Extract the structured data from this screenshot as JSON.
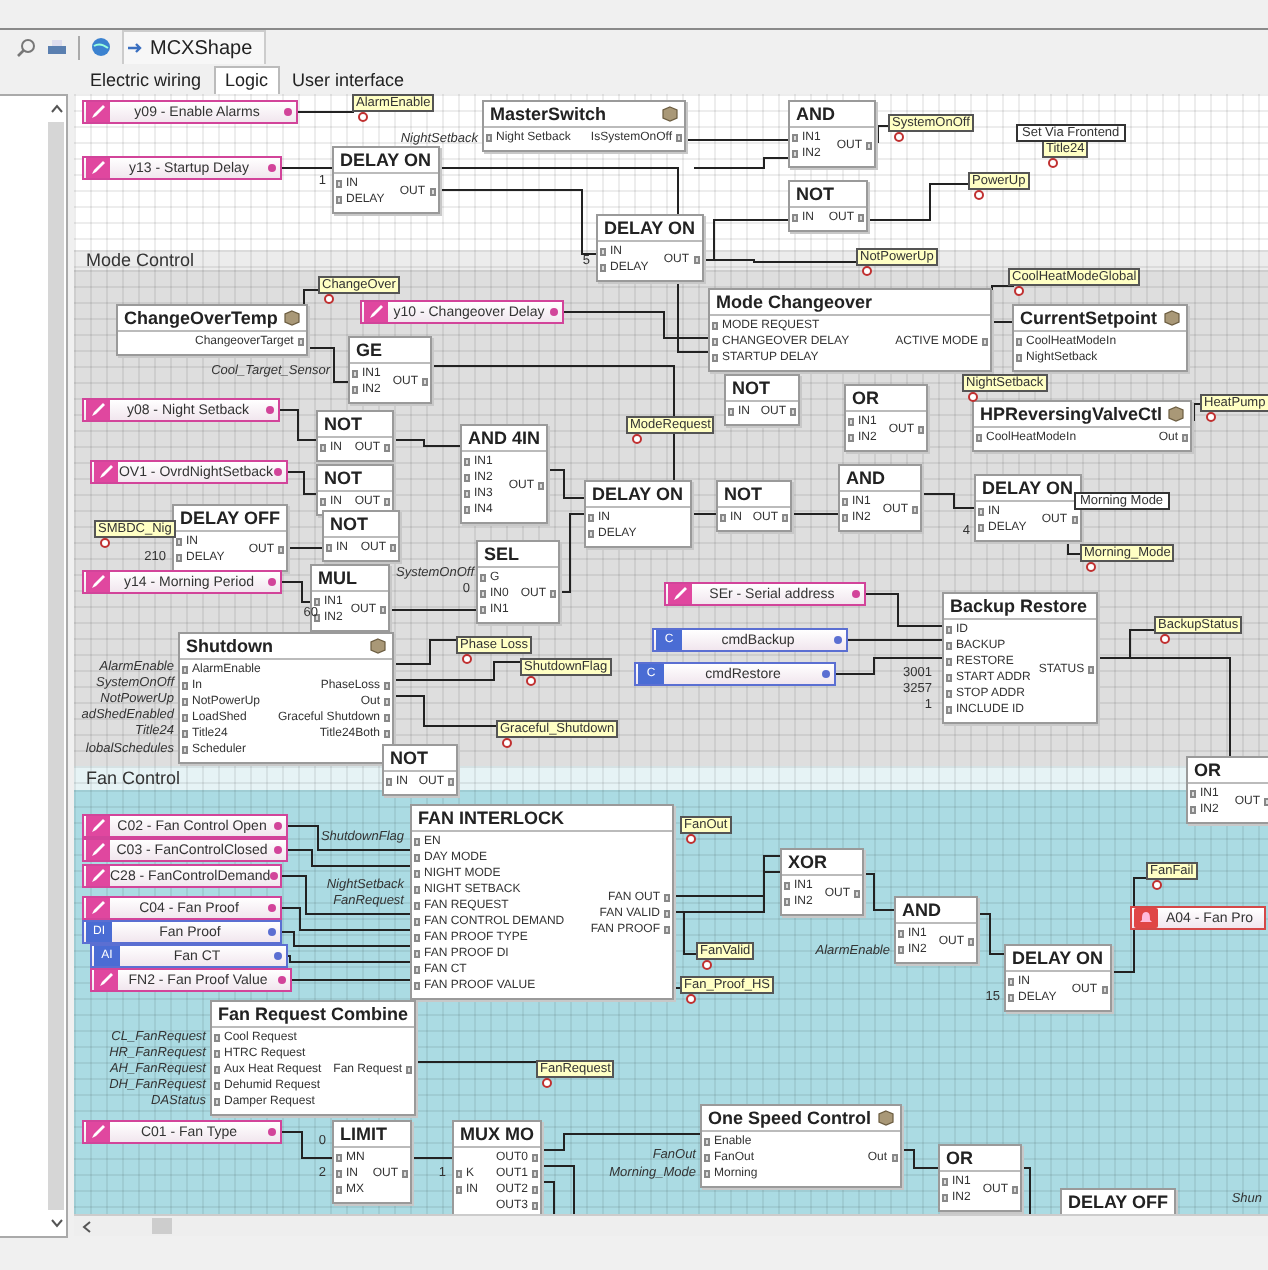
{
  "toolbar": {
    "document_tab": "MCXShape"
  },
  "tabs": [
    {
      "label": "Electric wiring",
      "selected": false
    },
    {
      "label": "Logic",
      "selected": true
    },
    {
      "label": "User interface",
      "selected": false
    }
  ],
  "sections": [
    {
      "title": "Mode Control"
    },
    {
      "title": "Fan Control"
    }
  ],
  "blocks": [
    {
      "title": "MasterSwitch",
      "inputs": [
        "Night Setback"
      ],
      "outputs": [
        "IsSystemOnOff"
      ],
      "macro": true
    },
    {
      "title": "DELAY ON",
      "inputs": [
        "IN",
        "DELAY"
      ],
      "outputs": [
        "OUT"
      ],
      "macro": false
    },
    {
      "title": "AND",
      "inputs": [
        "IN1",
        "IN2"
      ],
      "outputs": [
        "OUT"
      ],
      "macro": false
    },
    {
      "title": "NOT",
      "inputs": [
        "IN"
      ],
      "outputs": [
        "OUT"
      ],
      "macro": false
    },
    {
      "title": "DELAY ON",
      "inputs": [
        "IN",
        "DELAY"
      ],
      "outputs": [
        "OUT"
      ],
      "macro": false
    },
    {
      "title": "ChangeOverTemp",
      "outputs": [
        "ChangeoverTarget"
      ],
      "macro": true
    },
    {
      "title": "Mode Changeover",
      "inputs": [
        "MODE REQUEST",
        "CHANGEOVER DELAY",
        "STARTUP DELAY"
      ],
      "outputs": [
        "ACTIVE MODE"
      ],
      "macro": false
    },
    {
      "title": "CurrentSetpoint",
      "inputs": [
        "CoolHeatModeIn",
        "NightSetback"
      ],
      "macro": true
    },
    {
      "title": "GE",
      "inputs": [
        "IN1",
        "IN2"
      ],
      "outputs": [
        "OUT"
      ],
      "macro": false
    },
    {
      "title": "NOT",
      "inputs": [
        "IN"
      ],
      "outputs": [
        "OUT"
      ],
      "macro": false
    },
    {
      "title": "NOT",
      "inputs": [
        "IN"
      ],
      "outputs": [
        "OUT"
      ],
      "macro": false
    },
    {
      "title": "OR",
      "inputs": [
        "IN1",
        "IN2"
      ],
      "outputs": [
        "OUT"
      ],
      "macro": false
    },
    {
      "title": "HPReversingValveCtl",
      "inputs": [
        "CoolHeatModeIn"
      ],
      "outputs": [
        "Out"
      ],
      "macro": true
    },
    {
      "title": "NOT",
      "inputs": [
        "IN"
      ],
      "outputs": [
        "OUT"
      ],
      "macro": false
    },
    {
      "title": "AND 4IN",
      "inputs": [
        "IN1",
        "IN2",
        "IN3",
        "IN4"
      ],
      "outputs": [
        "OUT"
      ],
      "macro": false
    },
    {
      "title": "DELAY ON",
      "inputs": [
        "IN",
        "DELAY"
      ],
      "macro": false
    },
    {
      "title": "NOT",
      "inputs": [
        "IN"
      ],
      "outputs": [
        "OUT"
      ],
      "macro": false
    },
    {
      "title": "AND",
      "inputs": [
        "IN1",
        "IN2"
      ],
      "outputs": [
        "OUT"
      ],
      "macro": false
    },
    {
      "title": "DELAY ON",
      "inputs": [
        "IN",
        "DELAY"
      ],
      "outputs": [
        "OUT"
      ],
      "macro": false
    },
    {
      "title": "DELAY OFF",
      "inputs": [
        "IN",
        "DELAY"
      ],
      "outputs": [
        "OUT"
      ],
      "macro": false
    },
    {
      "title": "NOT",
      "inputs": [
        "IN"
      ],
      "outputs": [
        "OUT"
      ],
      "macro": false
    },
    {
      "title": "MUL",
      "inputs": [
        "IN1",
        "IN2"
      ],
      "outputs": [
        "OUT"
      ],
      "macro": false
    },
    {
      "title": "SEL",
      "inputs": [
        "G",
        "IN0",
        "IN1"
      ],
      "outputs": [
        "OUT"
      ],
      "macro": false
    },
    {
      "title": "Shutdown",
      "inputs": [
        "AlarmEnable",
        "In",
        "NotPowerUp",
        "LoadShed",
        "Title24",
        "Scheduler"
      ],
      "outputs": [
        "PhaseLoss",
        "Out",
        "Graceful Shutdown",
        "Title24Both"
      ],
      "macro": true
    },
    {
      "title": "Backup Restore",
      "inputs": [
        "ID",
        "BACKUP",
        "RESTORE",
        "START ADDR",
        "STOP ADDR",
        "INCLUDE ID"
      ],
      "outputs": [
        "STATUS"
      ],
      "macro": false
    },
    {
      "title": "NOT",
      "inputs": [
        "IN"
      ],
      "outputs": [
        "OUT"
      ],
      "macro": false
    },
    {
      "title": "OR",
      "inputs": [
        "IN1",
        "IN2"
      ],
      "outputs": [
        "OUT"
      ],
      "macro": false
    },
    {
      "title": "FAN INTERLOCK",
      "inputs": [
        "EN",
        "DAY MODE",
        "NIGHT MODE",
        "NIGHT SETBACK",
        "FAN REQUEST",
        "FAN CONTROL DEMAND",
        "FAN PROOF TYPE",
        "FAN PROOF DI",
        "FAN CT",
        "FAN PROOF VALUE"
      ],
      "outputs": [
        "FAN OUT",
        "FAN VALID",
        "FAN PROOF"
      ],
      "macro": false
    },
    {
      "title": "XOR",
      "inputs": [
        "IN1",
        "IN2"
      ],
      "outputs": [
        "OUT"
      ],
      "macro": false
    },
    {
      "title": "AND",
      "inputs": [
        "IN1",
        "IN2"
      ],
      "outputs": [
        "OUT"
      ],
      "macro": false
    },
    {
      "title": "DELAY ON",
      "inputs": [
        "IN",
        "DELAY"
      ],
      "outputs": [
        "OUT"
      ],
      "macro": false
    },
    {
      "title": "Fan Request Combine",
      "inputs": [
        "Cool Request",
        "HTRC Request",
        "Aux Heat Request",
        "Dehumid Request",
        "Damper Request"
      ],
      "outputs": [
        "Fan Request"
      ],
      "macro": false
    },
    {
      "title": "LIMIT",
      "inputs": [
        "MN",
        "IN",
        "MX"
      ],
      "outputs": [
        "OUT"
      ],
      "macro": false
    },
    {
      "title": "MUX MO",
      "inputs": [
        "K",
        "IN"
      ],
      "outputs": [
        "OUT0",
        "OUT1",
        "OUT2",
        "OUT3"
      ],
      "macro": false
    },
    {
      "title": "One Speed Control",
      "inputs": [
        "Enable",
        "FanOut",
        "Morning"
      ],
      "outputs": [
        "Out"
      ],
      "macro": true
    },
    {
      "title": "OR",
      "inputs": [
        "IN1",
        "IN2"
      ],
      "outputs": [
        "OUT"
      ],
      "macro": false
    },
    {
      "title": "DELAY OFF",
      "macro": false
    }
  ],
  "parameters": [
    {
      "kind": "parameter",
      "label": "y09 - Enable Alarms"
    },
    {
      "kind": "parameter",
      "label": "y13 - Startup Delay"
    },
    {
      "kind": "parameter",
      "label": "y10 - Changeover Delay"
    },
    {
      "kind": "parameter",
      "label": "y08 - Night Setback"
    },
    {
      "kind": "parameter",
      "label": "OV1 - OvrdNightSetback"
    },
    {
      "kind": "parameter",
      "label": "y14 - Morning Period"
    },
    {
      "kind": "parameter",
      "label": "SEr - Serial address"
    },
    {
      "kind": "command",
      "badge": "C",
      "label": "cmdBackup"
    },
    {
      "kind": "command",
      "badge": "C",
      "label": "cmdRestore"
    },
    {
      "kind": "parameter",
      "label": "C02 - Fan Control Open"
    },
    {
      "kind": "parameter",
      "label": "C03 - FanControlClosed"
    },
    {
      "kind": "parameter",
      "label": "C28 - FanControlDemand"
    },
    {
      "kind": "parameter",
      "label": "C04 - Fan Proof"
    },
    {
      "kind": "input",
      "badge": "DI",
      "label": "Fan Proof"
    },
    {
      "kind": "input",
      "badge": "AI",
      "label": "Fan CT"
    },
    {
      "kind": "parameter",
      "label": "FN2 - Fan Proof Value"
    },
    {
      "kind": "alarm",
      "label": "A04 - Fan Pro"
    },
    {
      "kind": "parameter",
      "label": "C01 - Fan Type"
    }
  ],
  "tags": [
    "AlarmEnable",
    "SystemOnOff",
    "Title24",
    "PowerUp",
    "NotPowerUp",
    "ChangeOver",
    "CoolHeatModeGlobal",
    "NightSetback",
    "HeatPump",
    "ModeRequest",
    "Morning_Mode",
    "SMBDC_Nig",
    "BackupStatus",
    "Phase Loss",
    "ShutdownFlag",
    "Graceful_Shutdown",
    "FanOut",
    "FanFail",
    "FanValid",
    "Fan_Proof_HS",
    "FanRequest"
  ],
  "notes": [
    "Set Via Frontend",
    "Morning Mode"
  ],
  "labels": [
    {
      "kind": "wire",
      "text": "NightSetback"
    },
    {
      "kind": "constant",
      "text": "1"
    },
    {
      "kind": "constant",
      "text": "5"
    },
    {
      "kind": "wire",
      "text": "Cool_Target_Sensor"
    },
    {
      "kind": "constant",
      "text": "210"
    },
    {
      "kind": "wire",
      "text": "SystemOnOff"
    },
    {
      "kind": "constant",
      "text": "0"
    },
    {
      "kind": "constant",
      "text": "60"
    },
    {
      "kind": "constant",
      "text": "3001"
    },
    {
      "kind": "constant",
      "text": "3257"
    },
    {
      "kind": "constant",
      "text": "1"
    },
    {
      "kind": "constant",
      "text": "4"
    },
    {
      "kind": "wire",
      "text": "AlarmEnable"
    },
    {
      "kind": "wire",
      "text": "SystemOnOff"
    },
    {
      "kind": "wire",
      "text": "NotPowerUp"
    },
    {
      "kind": "wire",
      "text": "adShedEnabled"
    },
    {
      "kind": "wire",
      "text": "Title24"
    },
    {
      "kind": "wire",
      "text": "lobalSchedules"
    },
    {
      "kind": "wire",
      "text": "ShutdownFlag"
    },
    {
      "kind": "wire",
      "text": "NightSetback"
    },
    {
      "kind": "wire",
      "text": "FanRequest"
    },
    {
      "kind": "wire",
      "text": "AlarmEnable"
    },
    {
      "kind": "constant",
      "text": "15"
    },
    {
      "kind": "wire",
      "text": "CL_FanRequest"
    },
    {
      "kind": "wire",
      "text": "HR_FanRequest"
    },
    {
      "kind": "wire",
      "text": "AH_FanRequest"
    },
    {
      "kind": "wire",
      "text": "DH_FanRequest"
    },
    {
      "kind": "wire",
      "text": "DAStatus"
    },
    {
      "kind": "constant",
      "text": "0"
    },
    {
      "kind": "constant",
      "text": "2"
    },
    {
      "kind": "constant",
      "text": "1"
    },
    {
      "kind": "wire",
      "text": "FanOut"
    },
    {
      "kind": "wire",
      "text": "Morning_Mode"
    },
    {
      "kind": "wire",
      "text": "Shun"
    }
  ]
}
